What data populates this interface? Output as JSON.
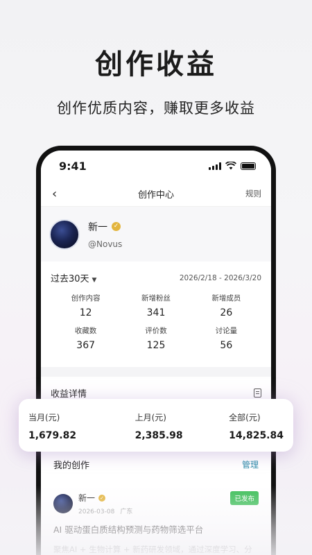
{
  "promo": {
    "headline": "创作收益",
    "subheadline": "创作优质内容，赚取更多收益"
  },
  "status_bar": {
    "time": "9:41"
  },
  "nav": {
    "back_icon": "chevron-left-icon",
    "title": "创作中心",
    "rule_label": "规则"
  },
  "profile": {
    "name": "新一",
    "handle": "@Novus",
    "verified_icon": "verified-badge-icon"
  },
  "stats": {
    "period": "过去30天",
    "period_caret": "▼",
    "date_range": "2026/2/18 - 2026/3/20",
    "items": [
      {
        "label": "创作内容",
        "value": "12"
      },
      {
        "label": "新增粉丝",
        "value": "341"
      },
      {
        "label": "新增成员",
        "value": "26"
      },
      {
        "label": "收藏数",
        "value": "367"
      },
      {
        "label": "评价数",
        "value": "125"
      },
      {
        "label": "讨论量",
        "value": "56"
      }
    ]
  },
  "income": {
    "title": "收益详情",
    "items": [
      {
        "label": "当月(元)",
        "value": "1,679.82"
      },
      {
        "label": "上月(元)",
        "value": "2,385.98"
      },
      {
        "label": "全部(元)",
        "value": "14,825.84"
      }
    ]
  },
  "works": {
    "title": "我的创作",
    "manage_label": "管理",
    "post": {
      "author": "新一",
      "date": "2026-03-08",
      "location": "广东",
      "status": "已发布",
      "title": "AI 驱动蛋白质结构预测与药物筛选平台",
      "excerpt": "聚焦AI + 生物计算 + 新药研发领域，通过深度学习、分"
    }
  },
  "colors": {
    "accent": "#2a8aa8",
    "published": "#3fbf5a",
    "verified": "#e3b53e"
  }
}
